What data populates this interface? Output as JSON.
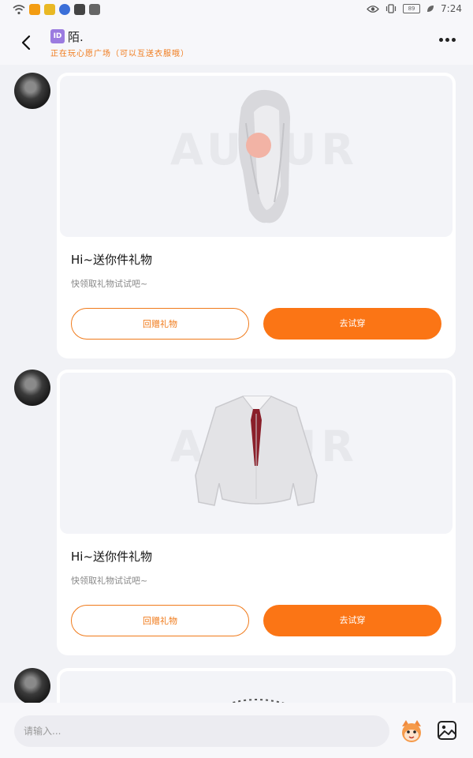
{
  "status_bar": {
    "time": "7:24",
    "battery": "89"
  },
  "header": {
    "id_badge": "ID",
    "name": "陌.",
    "subtitle": "正在玩心愿广场（可以互送衣服哦）"
  },
  "messages": [
    {
      "title": "Hi~送你件礼物",
      "desc": "快领取礼物试试吧~",
      "return_label": "回赠礼物",
      "try_label": "去试穿",
      "watermark": "AUPUR"
    },
    {
      "title": "Hi~送你件礼物",
      "desc": "快领取礼物试试吧~",
      "return_label": "回赠礼物",
      "try_label": "去试穿",
      "watermark": "AUPUR"
    }
  ],
  "input": {
    "placeholder": "请输入..."
  },
  "colors": {
    "accent": "#fb7515",
    "background": "#f1f2f6"
  }
}
